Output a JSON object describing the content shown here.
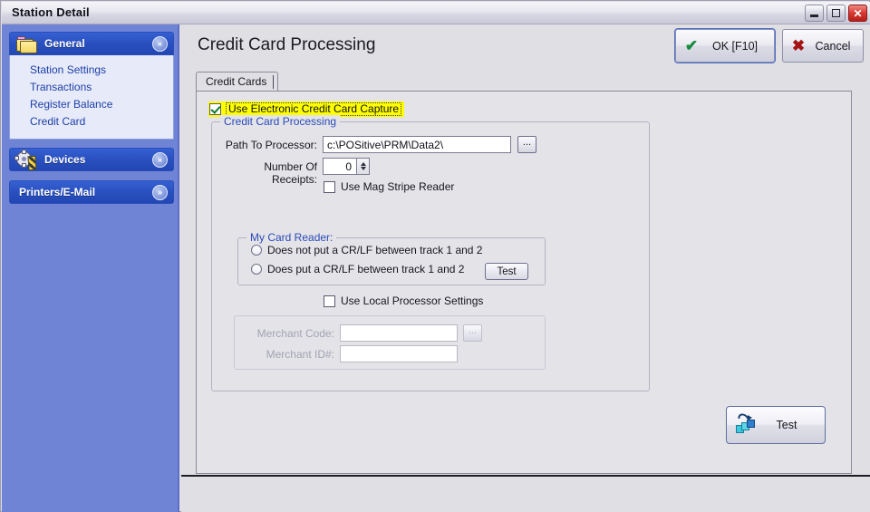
{
  "window": {
    "title": "Station Detail",
    "controls": {
      "minimize": "minimize-button",
      "maximize": "maximize-button",
      "close_glyph": "✕"
    }
  },
  "sidebar": {
    "groups": [
      {
        "label": "General",
        "icon": "folder-icon",
        "expanded": true,
        "chevron": "«",
        "items": [
          {
            "label": "Station Settings"
          },
          {
            "label": "Transactions"
          },
          {
            "label": "Register Balance"
          },
          {
            "label": "Credit Card"
          }
        ]
      },
      {
        "label": "Devices",
        "icon": "gear-icon",
        "expanded": false,
        "chevron": "»",
        "items": []
      },
      {
        "label": "Printers/E-Mail",
        "icon": "none",
        "expanded": false,
        "chevron": "»",
        "items": []
      }
    ]
  },
  "content": {
    "page_title": "Credit Card Processing",
    "buttons": {
      "ok": {
        "label": "OK [F10]",
        "icon": "check-icon",
        "glyph": "✔"
      },
      "cancel": {
        "label": "Cancel",
        "icon": "cross-icon",
        "glyph": "✖"
      }
    },
    "tabs": [
      {
        "label": "Credit Cards",
        "active": true
      }
    ],
    "use_electronic_capture": {
      "label": "Use Electronic Credit Card Capture",
      "checked": true,
      "highlight_color": "#ffff00"
    },
    "credit_card_processing": {
      "group_title": "Credit Card Processing",
      "path_to_processor": {
        "label": "Path To Processor:",
        "value": "c:\\POSitive\\PRM\\Data2\\",
        "browse_label": "..."
      },
      "number_of_receipts": {
        "label": "Number Of Receipts:",
        "value": "0"
      },
      "use_mag_stripe_reader": {
        "label": "Use Mag Stripe Reader",
        "checked": false
      },
      "my_card_reader": {
        "group_title": "My Card Reader:",
        "options": [
          {
            "label": "Does not put a CR/LF between track 1 and 2",
            "selected": false
          },
          {
            "label": "Does put a CR/LF between track 1 and 2",
            "selected": false
          }
        ],
        "test_label": "Test"
      },
      "use_local_processor_settings": {
        "label": "Use Local Processor Settings",
        "checked": false
      },
      "merchant": {
        "code": {
          "label": "Merchant Code:",
          "value": "",
          "browse_label": "...",
          "disabled": true
        },
        "id": {
          "label": "Merchant ID#:",
          "value": "",
          "disabled": true
        }
      }
    },
    "main_test_button": {
      "label": "Test",
      "icon": "card-test-icon"
    }
  }
}
